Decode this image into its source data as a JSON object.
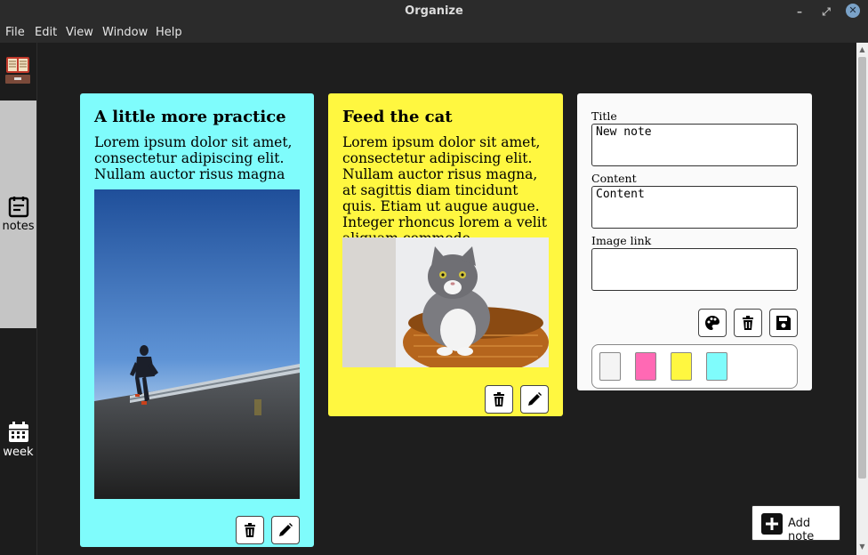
{
  "window": {
    "title": "Organize"
  },
  "menu": [
    "File",
    "Edit",
    "View",
    "Window",
    "Help"
  ],
  "sidebar": {
    "items": [
      {
        "label": "notes",
        "icon": "notes-icon",
        "active": true
      },
      {
        "label": "week",
        "icon": "calendar-icon",
        "active": false
      }
    ]
  },
  "notes": [
    {
      "title": "A little more practice",
      "content": "Lorem ipsum dolor sit amet, consectetur adipiscing elit. Nullam auctor risus magna",
      "color": "#7ffcfc",
      "image": "runner-on-road-photo"
    },
    {
      "title": "Feed the cat",
      "content": "Lorem ipsum dolor sit amet, consectetur adipiscing elit. Nullam auctor risus magna, at sagittis diam tincidunt quis. Etiam ut augue augue. Integer rhoncus lorem a velit aliquam commodo.",
      "color": "#fff740",
      "image": "cat-in-basket-photo"
    }
  ],
  "form": {
    "title_label": "Title",
    "title_value": "New note",
    "content_label": "Content",
    "content_value": "Content",
    "image_label": "Image link",
    "image_value": "",
    "swatches": [
      "#f4f4f4",
      "#ff69b4",
      "#fff740",
      "#7ffcfc"
    ]
  },
  "add_button": {
    "label": "Add note"
  }
}
